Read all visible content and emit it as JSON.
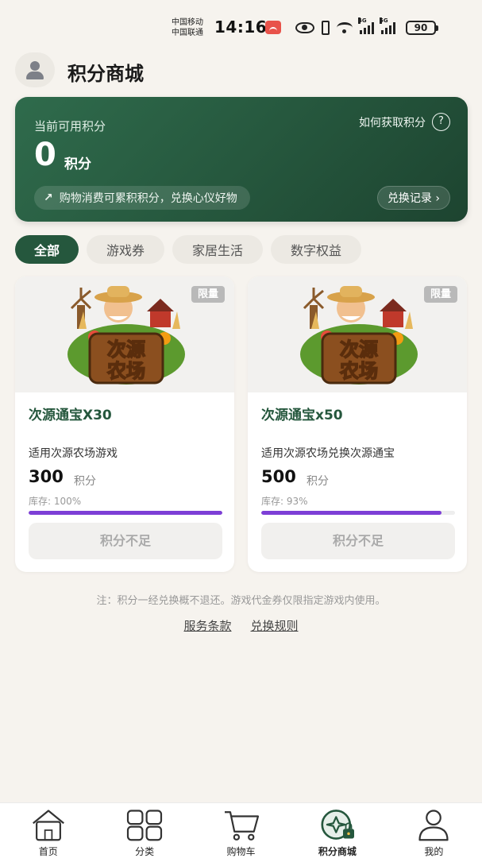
{
  "status_bar": {
    "carrier_1": "中国移动",
    "carrier_2": "中国联通",
    "time": "14:16",
    "battery": "90",
    "network_1": "4G",
    "network_2": "5G",
    "icons": [
      "notification-icon",
      "eye-icon",
      "vibrate-icon",
      "wifi-icon",
      "signal-icon",
      "battery-icon"
    ]
  },
  "header": {
    "title": "积分商城",
    "avatar_icon": "user-avatar-icon"
  },
  "points_card": {
    "label": "当前可用积分",
    "value": "0",
    "unit": "积分",
    "how_to_link": "如何获取积分",
    "help_icon_glyph": "?",
    "promo_text": "购物消费可累积积分，兑换心仪好物",
    "promo_icon_glyph": "↗",
    "history_button": "兑换记录 ›"
  },
  "tabs": [
    {
      "label": "全部",
      "active": true
    },
    {
      "label": "游戏券",
      "active": false
    },
    {
      "label": "家居生活",
      "active": false
    },
    {
      "label": "数字权益",
      "active": false
    }
  ],
  "products": [
    {
      "badge": "限量",
      "logo_text_1": "次源",
      "logo_text_2": "农场",
      "title": "次源通宝X30",
      "desc": "适用次源农场游戏",
      "price": "300",
      "price_unit": "积分",
      "stock_text": "库存: 100%",
      "stock_fraction": 1.0,
      "button": "积分不足"
    },
    {
      "badge": "限量",
      "logo_text_1": "次源",
      "logo_text_2": "农场",
      "title": "次源通宝x50",
      "desc": "适用次源农场兑换次源通宝",
      "price": "500",
      "price_unit": "积分",
      "stock_text": "库存: 93%",
      "stock_fraction": 0.93,
      "button": "积分不足"
    }
  ],
  "note": "注：积分一经兑换概不退还。游戏代金券仅限指定游戏内使用。",
  "links": {
    "terms": "服务条款",
    "rules": "兑换规则"
  },
  "bottom_nav": [
    {
      "label": "首页",
      "icon": "home-icon",
      "active": false
    },
    {
      "label": "分类",
      "icon": "grid-icon",
      "active": false
    },
    {
      "label": "购物车",
      "icon": "cart-icon",
      "active": false
    },
    {
      "label": "积分商城",
      "icon": "points-mall-icon",
      "active": true
    },
    {
      "label": "我的",
      "icon": "user-icon",
      "active": false
    }
  ],
  "colors": {
    "accent_green": "#25573d",
    "stock_bar": "#7d3fd6",
    "background": "#f6f3ee"
  }
}
